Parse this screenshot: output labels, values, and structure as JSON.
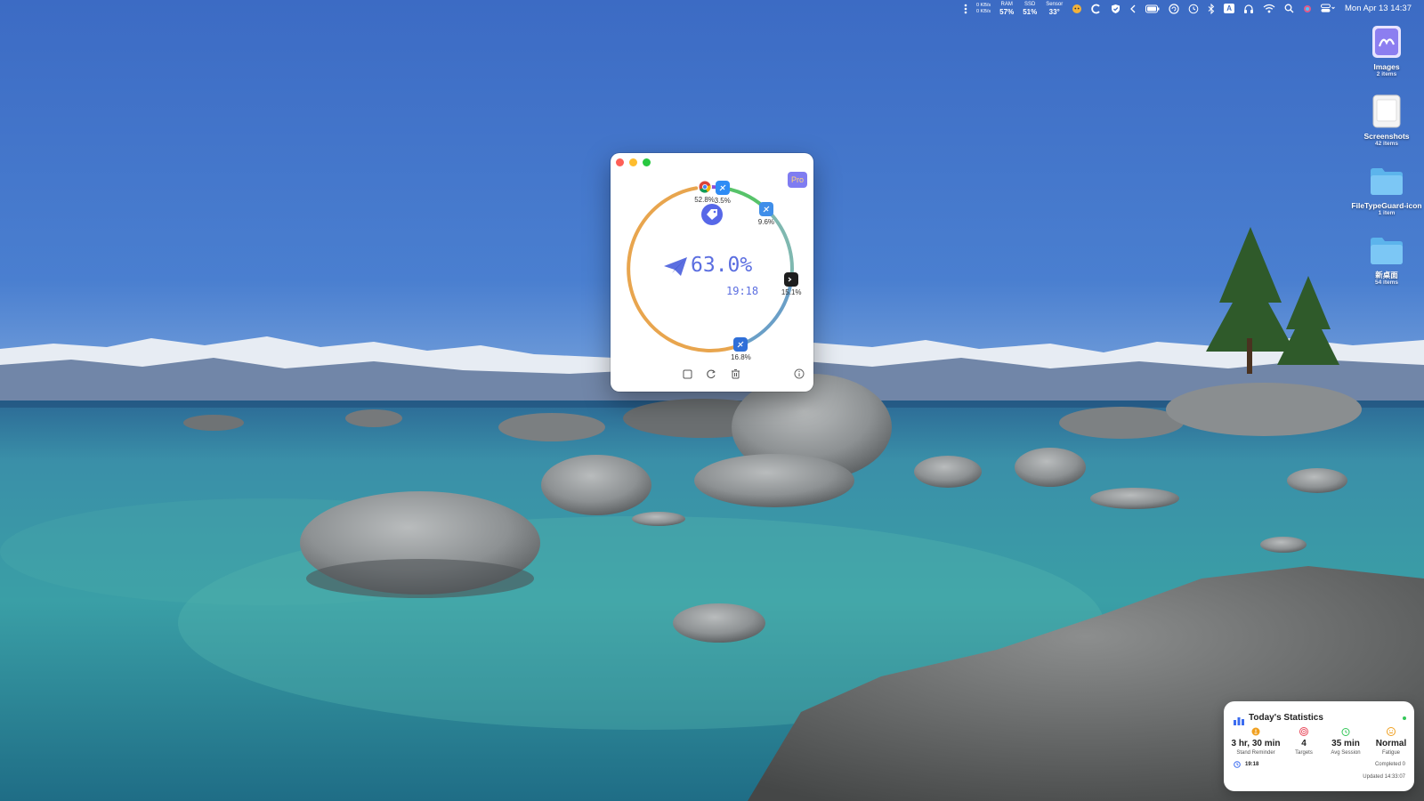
{
  "menubar": {
    "net_up": "0 KB/s",
    "net_down": "0 KB/s",
    "ram_label": "RAM",
    "ram_value": "57%",
    "ssd_label": "SSD",
    "ssd_value": "51%",
    "sensor_label": "Sensor",
    "sensor_value": "33°",
    "input_badge": "A",
    "clock": "Mon Apr 13  14:37",
    "icons": [
      "dots-icon",
      "cat-icon",
      "c-icon",
      "shield-icon",
      "chevron-left-icon",
      "battery-icon",
      "refresh-circle-icon",
      "clock-icon",
      "bluetooth-icon",
      "input-source-icon",
      "headphones-icon",
      "wifi-icon",
      "search-icon",
      "siri-icon",
      "control-center-icon"
    ]
  },
  "desktop": {
    "items": [
      {
        "name": "Images",
        "count": "2 items",
        "icon": "image-file-icon"
      },
      {
        "name": "Screenshots",
        "count": "42 items",
        "icon": "screenshot-file-icon"
      },
      {
        "name": "FileTypeGuard-icon",
        "count": "1 item",
        "icon": "folder-icon"
      },
      {
        "name": "新桌面",
        "count": "54 items",
        "icon": "folder-icon"
      }
    ]
  },
  "app_window": {
    "pro_badge": "Pro",
    "center_percent": "63.0%",
    "center_time": "19:18",
    "segments": [
      {
        "app": "Chrome",
        "icon": "chrome-icon",
        "percent_label": "52.8%",
        "share": 0.528,
        "color": "#e8a54e"
      },
      {
        "app": "App Store",
        "icon": "app-store-icon",
        "percent_label": "3.5%",
        "share": 0.035,
        "color": "#8a4fd8"
      },
      {
        "app": "Finder",
        "icon": "finder-icon",
        "percent_label": "9.6%",
        "share": 0.096,
        "color": "#57c36a"
      },
      {
        "app": "Terminal",
        "icon": "terminal-icon",
        "percent_label": "15.1%",
        "share": 0.151,
        "color": "#7fb8b0"
      },
      {
        "app": "Xcode",
        "icon": "xcode-icon",
        "percent_label": "16.8%",
        "share": 0.168,
        "color": "#6a9fc7"
      }
    ],
    "toolbar": [
      "stop-square-icon",
      "reset-icon",
      "trash-icon",
      "info-icon"
    ]
  },
  "stats_widget": {
    "title": "Today's Statistics",
    "columns": [
      {
        "value": "3 hr, 30 min",
        "label": "Stand Reminder",
        "icon": "stand-icon",
        "color": "#f0a020"
      },
      {
        "value": "4",
        "label": "Targets",
        "icon": "target-icon",
        "color": "#e84b5d"
      },
      {
        "value": "35 min",
        "label": "Avg Session",
        "icon": "timer-icon",
        "color": "#34c759"
      },
      {
        "value": "Normal",
        "label": "Fatigue",
        "icon": "fatigue-icon",
        "color": "#f0a020"
      }
    ],
    "timer": "19:18",
    "completed": "Completed 0",
    "updated": "Updated 14:33:07"
  }
}
